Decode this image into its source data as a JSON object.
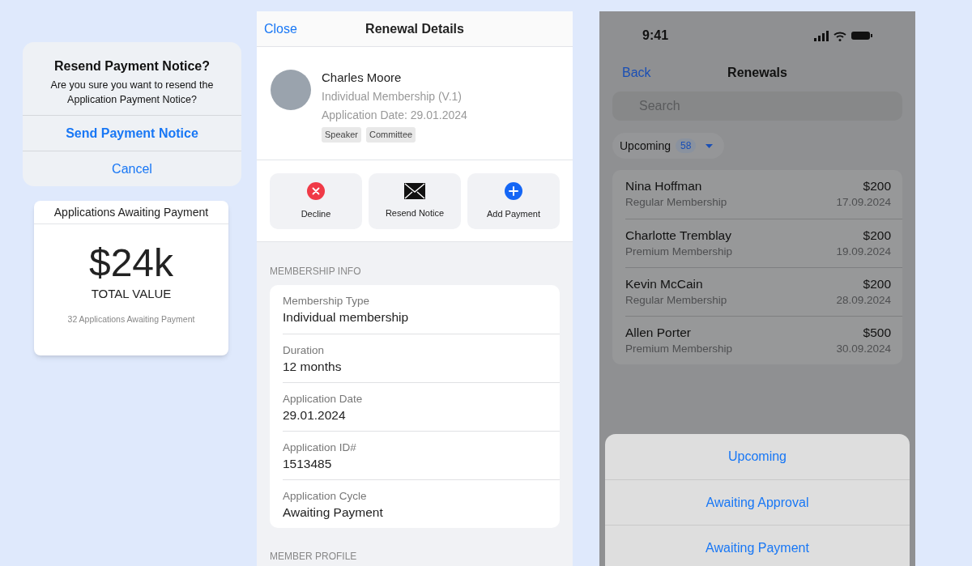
{
  "alert": {
    "title": "Resend Payment Notice?",
    "message": "Are you sure you want to resend the Application Payment Notice?",
    "actions": [
      {
        "label": "Send Payment Notice",
        "primary": true
      },
      {
        "label": "Cancel",
        "primary": false
      }
    ]
  },
  "summary_card": {
    "title": "Applications Awaiting Payment",
    "value": "$24k",
    "value_label": "TOTAL VALUE",
    "caption": "32 Applications Awaiting Payment"
  },
  "details": {
    "close": "Close",
    "title": "Renewal Details",
    "profile": {
      "name": "Charles Moore",
      "membership": "Individual Membership (V.1)",
      "date": "Application Date: 29.01.2024",
      "tags": [
        "Speaker",
        "Committee"
      ]
    },
    "actions": [
      {
        "kind": "decline",
        "label": "Decline"
      },
      {
        "kind": "mail",
        "label": "Resend Notice"
      },
      {
        "kind": "add",
        "label": "Add Payment"
      }
    ],
    "section": "MEMBERSHIP INFO",
    "fields": [
      {
        "label": "Membership Type",
        "value": "Individual membership"
      },
      {
        "label": "Duration",
        "value": "12 months"
      },
      {
        "label": "Application Date",
        "value": "29.01.2024"
      },
      {
        "label": "Application ID#",
        "value": "1513485"
      },
      {
        "label": "Application Cycle",
        "value": "Awaiting Payment"
      }
    ],
    "next_section": "MEMBER PROFILE"
  },
  "renewals": {
    "status_time": "9:41",
    "back": "Back",
    "title": "Renewals",
    "search": {
      "placeholder": "Search"
    },
    "filter": {
      "label": "Upcoming",
      "count": "58"
    },
    "rows": [
      {
        "name": "Nina Hoffman",
        "type": "Regular Membership",
        "amount": "$200",
        "date": "17.09.2024"
      },
      {
        "name": "Charlotte Tremblay",
        "type": "Premium Membership",
        "amount": "$200",
        "date": "19.09.2024"
      },
      {
        "name": "Kevin McCain",
        "type": "Regular Membership",
        "amount": "$200",
        "date": "28.09.2024"
      },
      {
        "name": "Allen Porter",
        "type": "Premium Membership",
        "amount": "$500",
        "date": "30.09.2024"
      }
    ],
    "sheet": [
      "Upcoming",
      "Awaiting Approval",
      "Awaiting Payment"
    ]
  }
}
